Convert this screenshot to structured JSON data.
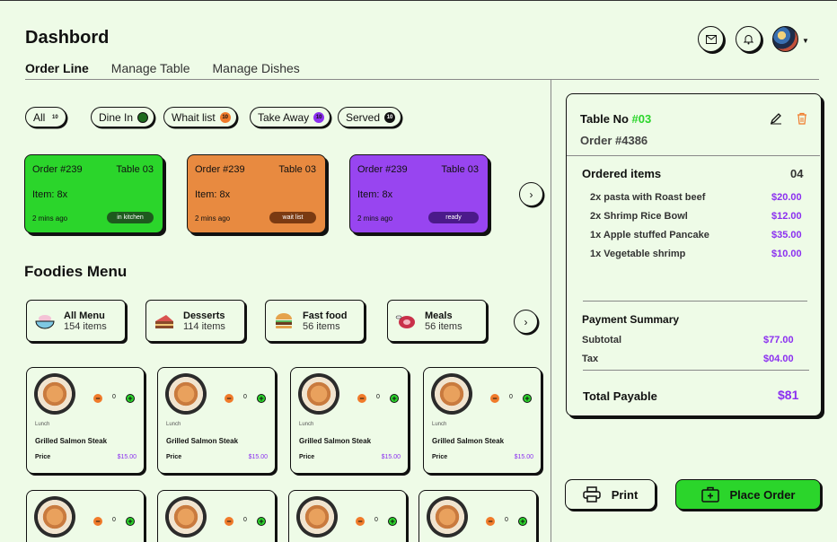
{
  "header": {
    "title": "Dashbord"
  },
  "tabs": [
    "Order Line",
    "Manage Table",
    "Manage Dishes"
  ],
  "filters": [
    {
      "label": "All",
      "count": "10",
      "color": "#eefbe7",
      "text": "#111"
    },
    {
      "label": "Dine In",
      "count": "",
      "color": "#1e6b1e",
      "text": "#fff"
    },
    {
      "label": "Whait list",
      "count": "10",
      "color": "#f07a2a",
      "text": "#111"
    },
    {
      "label": "Take Away",
      "count": "10",
      "color": "#8b2ff0",
      "text": "#111"
    },
    {
      "label": "Served",
      "count": "10",
      "color": "#111",
      "text": "#fff"
    }
  ],
  "orders": [
    {
      "order": "Order #239",
      "table": "Table 03",
      "items": "Item: 8x",
      "time": "2 mins ago",
      "status": "in kitchen",
      "color": "#2bd52b",
      "badge": "#1e5a1e"
    },
    {
      "order": "Order #239",
      "table": "Table 03",
      "items": "Item: 8x",
      "time": "2 mins ago",
      "status": "wait list",
      "color": "#e88a40",
      "badge": "#7a3a12"
    },
    {
      "order": "Order #239",
      "table": "Table 03",
      "items": "Item: 8x",
      "time": "2 mins ago",
      "status": "ready",
      "color": "#9845f0",
      "badge": "#4b1a8a"
    }
  ],
  "menu": {
    "title": "Foodies Menu",
    "categories": [
      {
        "name": "All  Menu",
        "count": "154 items",
        "icon": "bowl-icon"
      },
      {
        "name": "Desserts",
        "count": "114 items",
        "icon": "cake-icon"
      },
      {
        "name": "Fast food",
        "count": "56 items",
        "icon": "burger-icon"
      },
      {
        "name": "Meals",
        "count": "56 items",
        "icon": "meat-icon"
      }
    ]
  },
  "dishes": [
    {
      "category": "Lunch",
      "name": "Grilled Salmon Steak",
      "price_label": "Price",
      "price": "$15.00",
      "qty": "0"
    },
    {
      "category": "Lunch",
      "name": "Grilled Salmon Steak",
      "price_label": "Price",
      "price": "$15.00",
      "qty": "0"
    },
    {
      "category": "Lunch",
      "name": "Grilled Salmon Steak",
      "price_label": "Price",
      "price": "$15.00",
      "qty": "0"
    },
    {
      "category": "Lunch",
      "name": "Grilled Salmon Steak",
      "price_label": "Price",
      "price": "$15.00",
      "qty": "0"
    },
    {
      "qty": "0"
    },
    {
      "qty": "0"
    },
    {
      "qty": "0"
    },
    {
      "qty": "0"
    }
  ],
  "panel": {
    "table_label": "Table No ",
    "table_no": "#03",
    "order_no": "Order #4386",
    "ordered_items_label": "Ordered items",
    "ordered_count": "04",
    "items": [
      {
        "name": "2x pasta with Roast beef",
        "price": "$20.00"
      },
      {
        "name": "2x Shrimp Rice Bowl",
        "price": "$12.00"
      },
      {
        "name": "1x Apple stuffed Pancake",
        "price": "$35.00"
      },
      {
        "name": "1x  Vegetable shrimp",
        "price": "$10.00"
      }
    ],
    "payment_title": "Payment Summary",
    "subtotal_label": "Subtotal",
    "subtotal": "$77.00",
    "tax_label": "Tax",
    "tax": "$04.00",
    "total_label": "Total Payable",
    "total": "$81"
  },
  "actions": {
    "print": "Print",
    "place_order": "Place Order"
  }
}
